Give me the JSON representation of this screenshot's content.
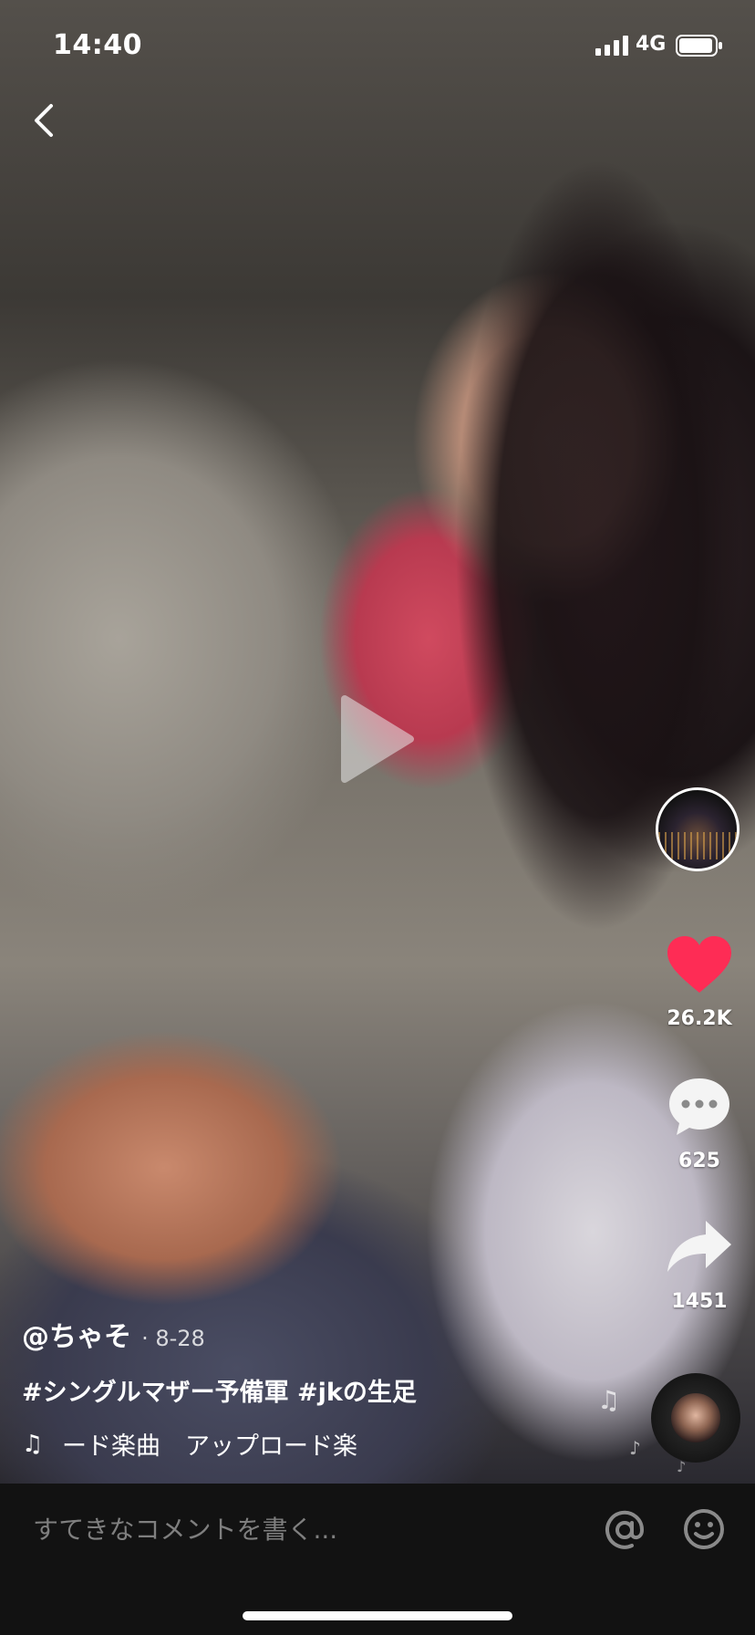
{
  "status_bar": {
    "time": "14:40",
    "network": "4G"
  },
  "post": {
    "username": "@ちゃそ",
    "date": "· 8-28",
    "hashtags": "#シングルマザー予備軍 #jkの生足",
    "music": "ード楽曲　アップロード楽"
  },
  "actions": {
    "likes": "26.2K",
    "comments": "625",
    "shares": "1451"
  },
  "comment_bar": {
    "placeholder": "すてきなコメントを書く..."
  },
  "colors": {
    "like": "#fe2c55",
    "comment_bar_bg": "#121212",
    "placeholder": "#7f7f7f"
  },
  "icons": [
    "back-icon",
    "play-icon",
    "heart-icon",
    "comment-icon",
    "share-icon",
    "music-note-icon",
    "at-icon",
    "emoji-icon"
  ]
}
